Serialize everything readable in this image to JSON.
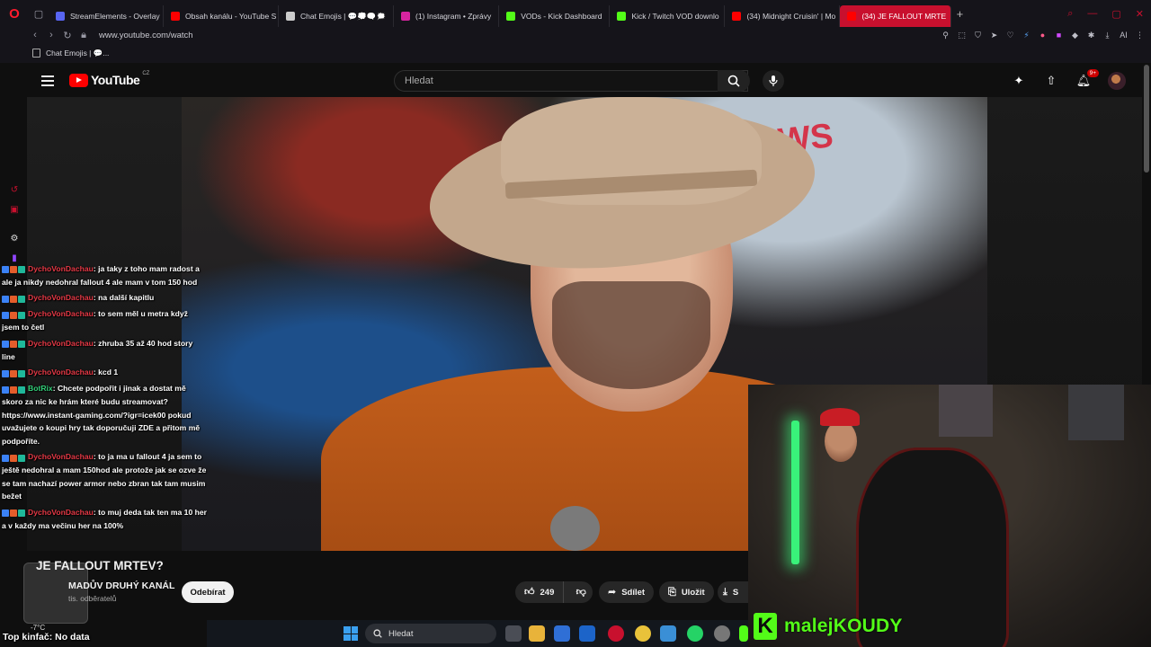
{
  "browser": {
    "tabs": [
      {
        "label": "StreamElements - Overlay",
        "fav_color": "#5865f2"
      },
      {
        "label": "Obsah kanálu - YouTube S",
        "fav_color": "#ff0000"
      },
      {
        "label": "Chat Emojis | 💬💭🗨️🗯️",
        "fav_color": "#cccccc"
      },
      {
        "label": "(1) Instagram • Zprávy",
        "fav_color": "#d6249f"
      },
      {
        "label": "VODs - Kick Dashboard",
        "fav_color": "#53fc18"
      },
      {
        "label": "Kick / Twitch VOD downlo",
        "fav_color": "#53fc18"
      },
      {
        "label": "(34) Midnight Cruisin' | Mo",
        "fav_color": "#ff0000"
      },
      {
        "label": "(34) JE FALLOUT MRTE",
        "fav_color": "#ff0000",
        "active": true
      }
    ],
    "url": "www.youtube.com/watch",
    "bookmark": "Chat Emojis | 💬..."
  },
  "youtube": {
    "logo_text": "YouTube",
    "logo_region": "CZ",
    "search_placeholder": "Hledat",
    "notification_badge": "9+",
    "video_title": "JE FALLOUT MRTEV?",
    "channel_name": "MADŮV DRUHÝ KANÁL",
    "subscribers": "tis. odběratelů",
    "subscribe_label": "Odebírat",
    "likes": "249",
    "share_label": "Sdílet",
    "save_label": "Uložit",
    "download_label": "S"
  },
  "video_overlay": {
    "sign_text": "WS"
  },
  "chat": [
    {
      "user": "DychoVonDachau",
      "text": ": ja taky z toho mam radost a ale ja nikdy nedohral fallout 4 ale mam v tom 150 hod",
      "bot": false
    },
    {
      "user": "DychoVonDachau",
      "text": ": na další kapitlu",
      "bot": false
    },
    {
      "user": "DychoVonDachau",
      "text": ": to sem měl u metra když jsem to četl",
      "bot": false
    },
    {
      "user": "DychoVonDachau",
      "text": ": zhruba 35 až 40 hod story line",
      "bot": false
    },
    {
      "user": "DychoVonDachau",
      "text": ": kcd 1",
      "bot": false
    },
    {
      "user": "BotRix",
      "text": ": Chcete podpořit i jinak a dostat mě skoro za nic ke hrám které budu streamovat? https://www.instant-gaming.com/?igr=icek00 pokud uvažujete o koupi hry tak doporučuji ZDE a přitom mě podpoříte.",
      "bot": true
    },
    {
      "user": "DychoVonDachau",
      "text": ": to ja ma u fallout 4 ja sem to ještě nedohral a mam 150hod ale protože jak se ozve že se tam nachazí power armor nebo zbran tak tam musim bežet",
      "bot": false
    },
    {
      "user": "DychoVonDachau",
      "text": ": to muj deda tak ten ma 10 her a v každy ma večinu her na 100%",
      "bot": false
    }
  ],
  "webcam": {
    "streamer_name": "malejKOUDY",
    "platform_letter": "K"
  },
  "taskbar": {
    "search_label": "Hledat",
    "weather_temp": "-7°C",
    "top_kinfo": "Top kinfač: No data"
  },
  "colors": {
    "accent": "#c8102e",
    "youtube_red": "#ff0000",
    "kick_green": "#53fc18",
    "chat_user": "#e63946",
    "bot_user": "#33d17a"
  },
  "icons": [
    "opera-icon",
    "menu-icon",
    "search-icon",
    "mic-icon",
    "create-icon",
    "upload-icon",
    "bell-icon",
    "like-icon",
    "dislike-icon",
    "share-icon",
    "save-icon",
    "download-icon",
    "windows-icon"
  ]
}
